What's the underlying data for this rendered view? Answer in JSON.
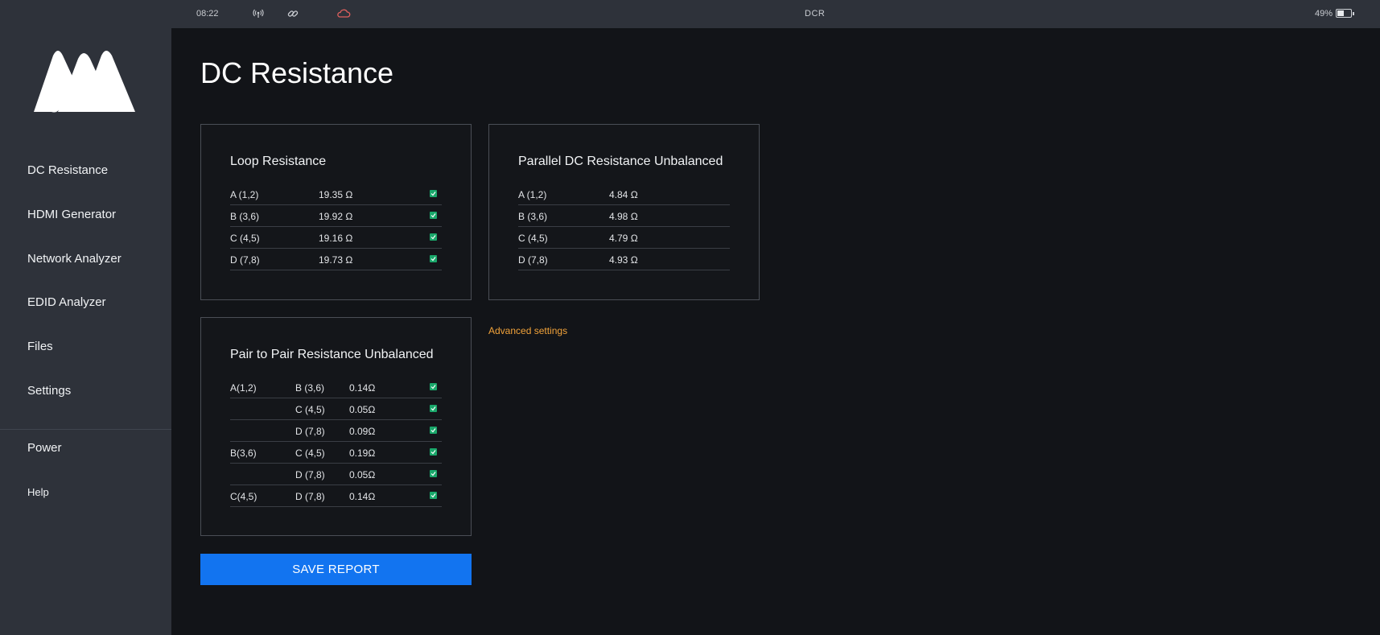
{
  "statusbar": {
    "time": "08:22",
    "mode": "DCR",
    "battery_percent": "49%",
    "battery_level": 0.49,
    "icons": [
      "antenna-icon",
      "link-icon",
      "cloud-icon"
    ],
    "cloud_color": "#e0605e"
  },
  "sidebar": {
    "items": [
      {
        "label": "DC Resistance"
      },
      {
        "label": "HDMI Generator"
      },
      {
        "label": "Network Analyzer"
      },
      {
        "label": "EDID Analyzer"
      },
      {
        "label": "Files"
      },
      {
        "label": "Settings"
      }
    ],
    "power_label": "Power",
    "help_label": "Help"
  },
  "page": {
    "title": "DC Resistance"
  },
  "loop": {
    "title": "Loop Resistance",
    "rows": [
      {
        "pair": "A (1,2)",
        "value": "19.35 Ω",
        "ok": true
      },
      {
        "pair": "B (3,6)",
        "value": "19.92 Ω",
        "ok": true
      },
      {
        "pair": "C (4,5)",
        "value": "19.16 Ω",
        "ok": true
      },
      {
        "pair": "D (7,8)",
        "value": "19.73 Ω",
        "ok": true
      }
    ]
  },
  "parallel": {
    "title": "Parallel DC Resistance Unbalanced",
    "rows": [
      {
        "pair": "A (1,2)",
        "value": "4.84 Ω"
      },
      {
        "pair": "B (3,6)",
        "value": "4.98 Ω"
      },
      {
        "pair": "C (4,5)",
        "value": "4.79 Ω"
      },
      {
        "pair": "D (7,8)",
        "value": "4.93 Ω"
      }
    ]
  },
  "pair_to_pair": {
    "title": "Pair to Pair Resistance Unbalanced",
    "rows": [
      {
        "from": "A(1,2)",
        "to": "B (3,6)",
        "value": "0.14Ω",
        "ok": true
      },
      {
        "from": "",
        "to": "C (4,5)",
        "value": "0.05Ω",
        "ok": true
      },
      {
        "from": "",
        "to": "D (7,8)",
        "value": "0.09Ω",
        "ok": true
      },
      {
        "from": "B(3,6)",
        "to": "C (4,5)",
        "value": "0.19Ω",
        "ok": true
      },
      {
        "from": "",
        "to": "D (7,8)",
        "value": "0.05Ω",
        "ok": true
      },
      {
        "from": "C(4,5)",
        "to": "D (7,8)",
        "value": "0.14Ω",
        "ok": true
      }
    ]
  },
  "advanced_settings_label": "Advanced settings",
  "save_report_label": "SAVE REPORT",
  "colors": {
    "accent": "#1274f0",
    "link": "#f2a33a",
    "check": "#1aa86b",
    "sidebar_bg": "#2e323a",
    "main_bg": "#121418"
  }
}
